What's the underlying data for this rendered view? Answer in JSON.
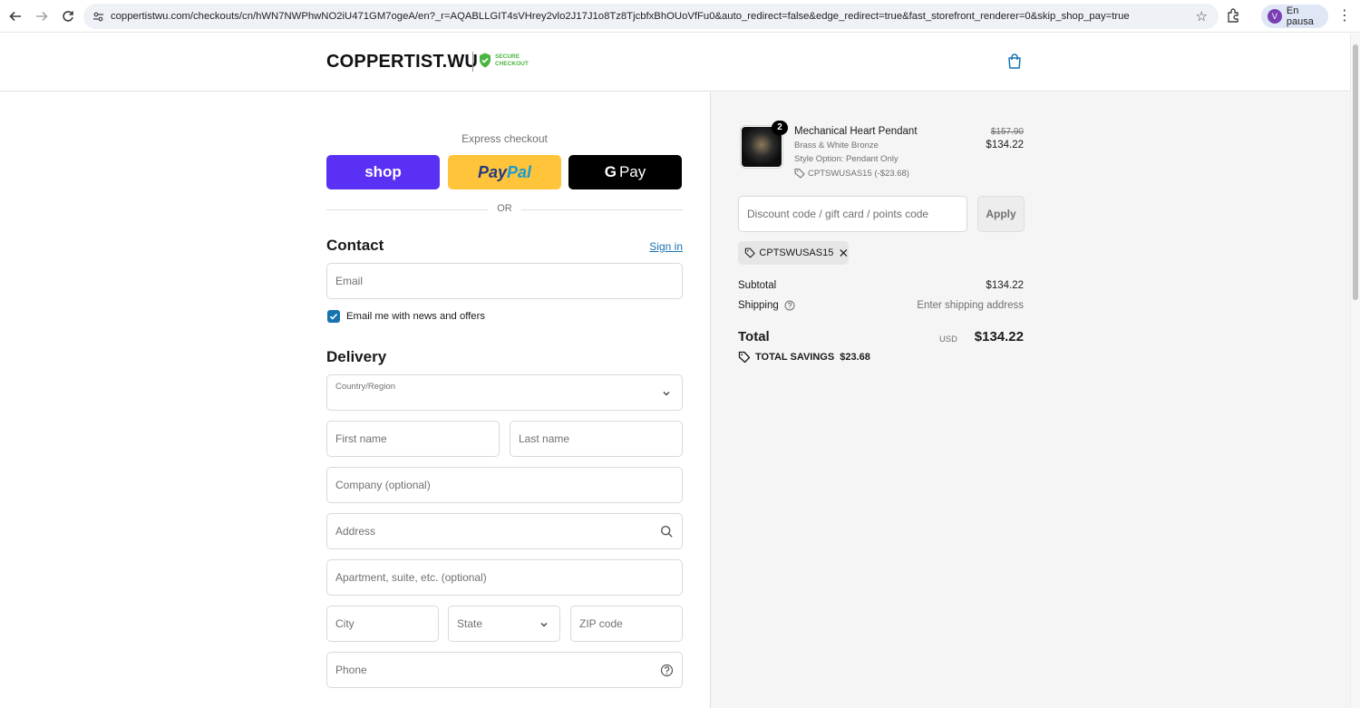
{
  "browser": {
    "url": "coppertistwu.com/checkouts/cn/hWN7NWPhwNO2iU471GM7ogeA/en?_r=AQABLLGIT4sVHrey2vlo2J17J1o8Tz8TjcbfxBhOUoVfFu0&auto_redirect=false&edge_redirect=true&fast_storefront_renderer=0&skip_shop_pay=true",
    "profile_initial": "V",
    "profile_label": "En pausa"
  },
  "header": {
    "logo": "COPPERTIST.WU",
    "secure_line1": "SECURE",
    "secure_line2": "CHECKOUT",
    "brand_color": "#4bb543"
  },
  "express": {
    "title": "Express checkout",
    "shop_label": "shop",
    "paypal_part1": "Pay",
    "paypal_part2": "Pal",
    "gpay_g": "G",
    "gpay_label": "Pay",
    "or_label": "OR"
  },
  "contact": {
    "title": "Contact",
    "sign_in": "Sign in",
    "email_placeholder": "Email",
    "newsletter_label": "Email me with news and offers",
    "newsletter_checked": true
  },
  "delivery": {
    "title": "Delivery",
    "country_label": "Country/Region",
    "first_name": "First name",
    "last_name": "Last name",
    "company": "Company (optional)",
    "address": "Address",
    "apartment": "Apartment, suite, etc. (optional)",
    "city": "City",
    "state": "State",
    "zip": "ZIP code",
    "phone": "Phone"
  },
  "summary": {
    "product": {
      "quantity": "2",
      "name": "Mechanical Heart Pendant",
      "variant": "Brass & White Bronze",
      "style": "Style Option: Pendant Only",
      "discount": "CPTSWUSAS15 (-$23.68)",
      "old_price": "$157.90",
      "price": "$134.22"
    },
    "discount_placeholder": "Discount code / gift card / points code",
    "apply_label": "Apply",
    "applied_code": "CPTSWUSAS15",
    "subtotal_label": "Subtotal",
    "subtotal_value": "$134.22",
    "shipping_label": "Shipping",
    "shipping_value": "Enter shipping address",
    "total_label": "Total",
    "total_currency": "USD",
    "total_value": "$134.22",
    "savings_label": "TOTAL SAVINGS",
    "savings_value": "$23.68"
  }
}
